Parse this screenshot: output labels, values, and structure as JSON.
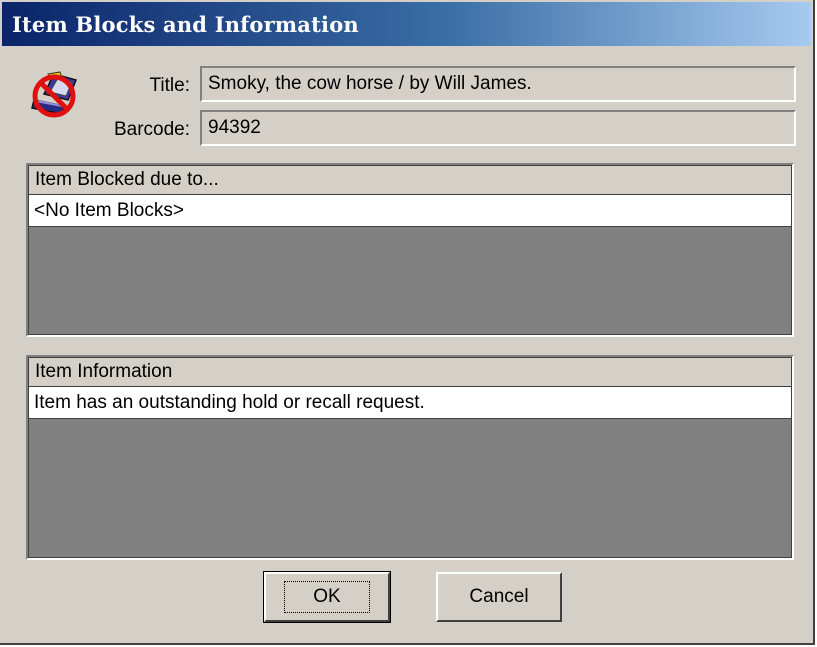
{
  "window": {
    "title": "Item Blocks and Information"
  },
  "icon": {
    "name": "no-item-icon"
  },
  "fields": {
    "title_label": "Title:",
    "title_value": "Smoky, the cow horse / by Will James.",
    "barcode_label": "Barcode:",
    "barcode_value": "94392"
  },
  "blocks": {
    "header": "Item Blocked due to...",
    "rows": [
      "<No Item Blocks>"
    ]
  },
  "information": {
    "header": "Item Information",
    "rows": [
      "Item has an outstanding hold or recall request."
    ]
  },
  "buttons": {
    "ok_label": "OK",
    "cancel_label": "Cancel"
  },
  "colors": {
    "title_bar_start": "#0a246a",
    "title_bar_end": "#a6caf0",
    "dialog_face": "#d4d0c8",
    "list_empty": "#808080"
  }
}
